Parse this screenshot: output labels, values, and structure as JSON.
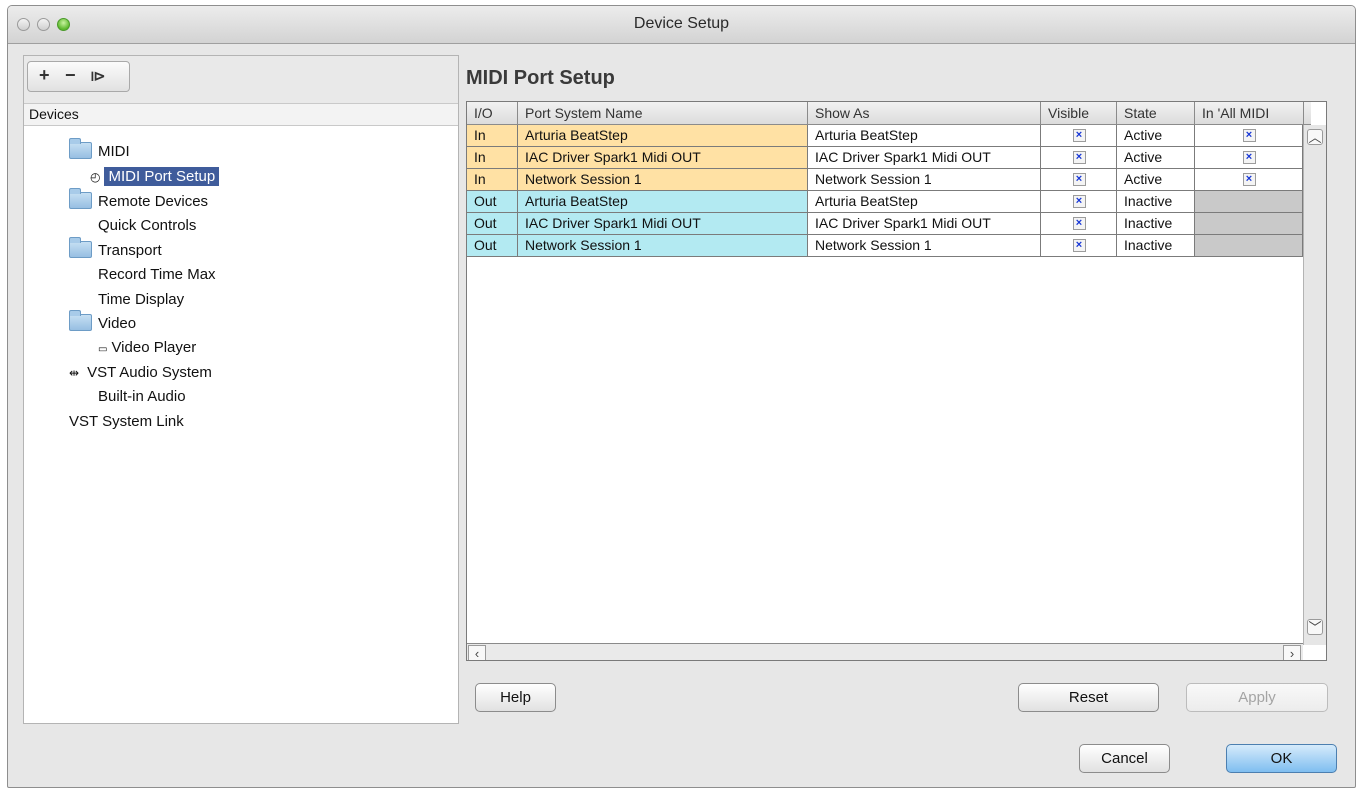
{
  "window": {
    "title": "Device Setup"
  },
  "toolbar": {
    "add": "+",
    "remove": "−",
    "reset": "⧐"
  },
  "devices": {
    "header": "Devices",
    "items": [
      {
        "label": "MIDI",
        "icon": "folder-icon"
      },
      {
        "label": "MIDI Port Setup",
        "icon": "midi-port-icon",
        "selected": true
      },
      {
        "label": "Remote Devices",
        "icon": "folder-icon"
      },
      {
        "label": "Quick Controls"
      },
      {
        "label": "Transport",
        "icon": "folder-icon"
      },
      {
        "label": "Record Time Max"
      },
      {
        "label": "Time Display"
      },
      {
        "label": "Video",
        "icon": "folder-icon"
      },
      {
        "label": "Video Player",
        "icon": "video-player-icon"
      },
      {
        "label": "VST Audio System",
        "icon": "audio-system-icon"
      },
      {
        "label": "Built-in Audio"
      },
      {
        "label": "VST System Link"
      }
    ]
  },
  "section": {
    "title": "MIDI Port Setup"
  },
  "table": {
    "columns": [
      "I/O",
      "Port System Name",
      "Show As",
      "Visible",
      "State",
      "In 'All MIDI"
    ],
    "rows": [
      {
        "io": "In",
        "port": "Arturia BeatStep",
        "show_as": "Arturia BeatStep",
        "visible": "×",
        "state": "Active",
        "all_midi": "×"
      },
      {
        "io": "In",
        "port": "IAC Driver Spark1 Midi OUT",
        "show_as": "IAC Driver Spark1 Midi OUT",
        "visible": "×",
        "state": "Active",
        "all_midi": "×"
      },
      {
        "io": "In",
        "port": "Network Session 1",
        "show_as": "Network Session 1",
        "visible": "×",
        "state": "Active",
        "all_midi": "×"
      },
      {
        "io": "Out",
        "port": "Arturia BeatStep",
        "show_as": "Arturia BeatStep",
        "visible": "×",
        "state": "Inactive",
        "all_midi": ""
      },
      {
        "io": "Out",
        "port": "IAC Driver Spark1 Midi OUT",
        "show_as": "IAC Driver Spark1 Midi OUT",
        "visible": "×",
        "state": "Inactive",
        "all_midi": ""
      },
      {
        "io": "Out",
        "port": "Network Session 1",
        "show_as": "Network Session 1",
        "visible": "×",
        "state": "Inactive",
        "all_midi": ""
      }
    ]
  },
  "buttons": {
    "help": "Help",
    "reset": "Reset",
    "apply": "Apply",
    "cancel": "Cancel",
    "ok": "OK"
  },
  "colors": {
    "in_row": "#ffe1a4",
    "out_row": "#b3eaf2",
    "selection": "#3f5c9b",
    "checkmark": "#1434d6"
  }
}
